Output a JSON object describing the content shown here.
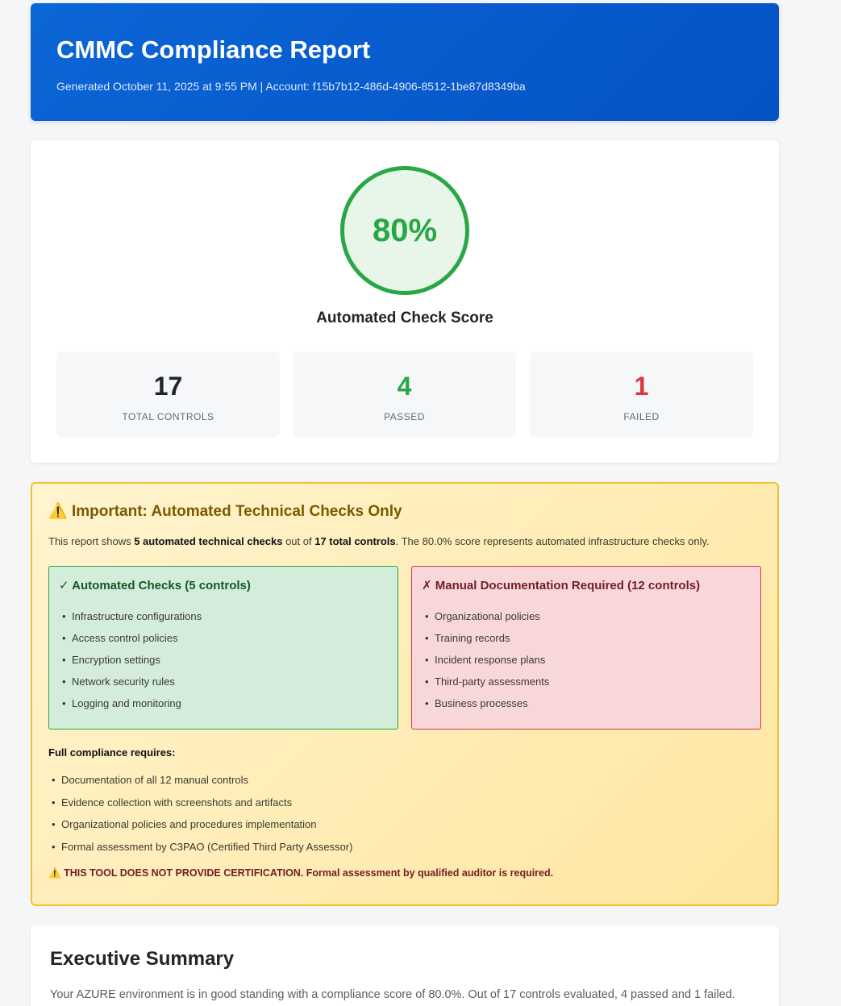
{
  "header": {
    "title": "CMMC Compliance Report",
    "meta": "Generated October 11, 2025 at 9:55 PM | Account: f15b7b12-486d-4906-8512-1be87d8349ba"
  },
  "score": {
    "value": "80%",
    "label": "Automated Check Score",
    "stats": [
      {
        "value": "17",
        "label": "TOTAL CONTROLS",
        "color": "#212529"
      },
      {
        "value": "4",
        "label": "PASSED",
        "color": "#28a745"
      },
      {
        "value": "1",
        "label": "FAILED",
        "color": "#dc3545"
      }
    ]
  },
  "warning": {
    "icon": "warning-icon",
    "title": "Important: Automated Technical Checks Only",
    "intro_prefix": "This report shows ",
    "intro_bold1": "5 automated technical checks",
    "intro_mid": " out of ",
    "intro_bold2": "17 total controls",
    "intro_suffix": ". The 80.0% score represents automated infrastructure checks only.",
    "automated": {
      "title": "✓ Automated Checks (5 controls)",
      "items": [
        "Infrastructure configurations",
        "Access control policies",
        "Encryption settings",
        "Network security rules",
        "Logging and monitoring"
      ]
    },
    "manual": {
      "title": "✗ Manual Documentation Required (12 controls)",
      "items": [
        "Organizational policies",
        "Training records",
        "Incident response plans",
        "Third-party assessments",
        "Business processes"
      ]
    },
    "requirements_title": "Full compliance requires:",
    "requirements": [
      "Documentation of all 12 manual controls",
      "Evidence collection with screenshots and artifacts",
      "Organizational policies and procedures implementation",
      "Formal assessment by C3PAO (Certified Third Party Assessor)"
    ],
    "disclaimer": "THIS TOOL DOES NOT PROVIDE CERTIFICATION. Formal assessment by qualified auditor is required."
  },
  "summary": {
    "title": "Executive Summary",
    "text": "Your AZURE environment is in good standing with a compliance score of 80.0%. Out of 17 controls evaluated, 4 passed and 1 failed."
  }
}
